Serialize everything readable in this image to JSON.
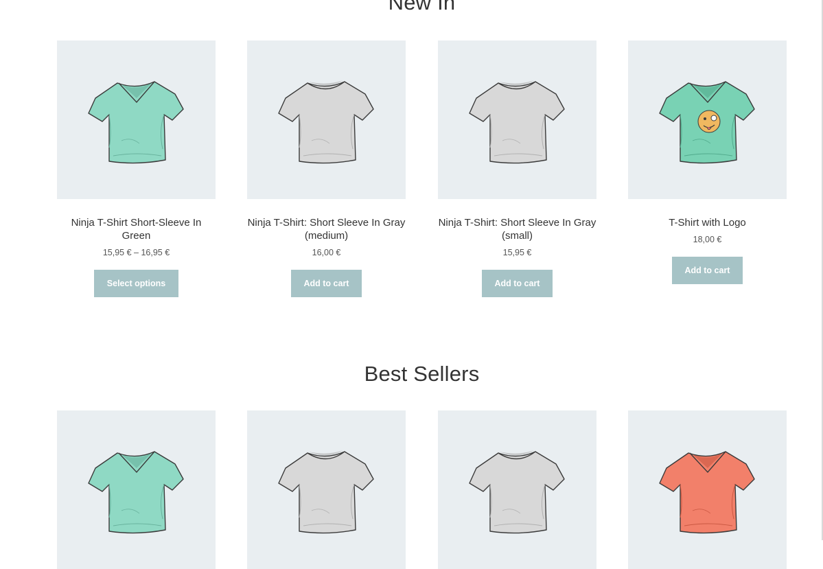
{
  "sections": [
    {
      "title": "New In",
      "products": [
        {
          "name": "Ninja T-Shirt Short-Sleeve In Green",
          "price": "15,95 € – 16,95 €",
          "button": "Select options",
          "shirt": "vneck",
          "color": "#8fd9c4",
          "logo": false
        },
        {
          "name": "Ninja T-Shirt: Short Sleeve In Gray (medium)",
          "price": "16,00 €",
          "button": "Add to cart",
          "shirt": "crew",
          "color": "#d8d8d8",
          "logo": false
        },
        {
          "name": "Ninja T-Shirt: Short Sleeve In Gray (small)",
          "price": "15,95 €",
          "button": "Add to cart",
          "shirt": "crew",
          "color": "#d8d8d8",
          "logo": false
        },
        {
          "name": "T-Shirt with Logo",
          "price": "18,00 €",
          "button": "Add to cart",
          "shirt": "vneck",
          "color": "#79d2b4",
          "logo": true
        }
      ]
    },
    {
      "title": "Best Sellers",
      "products": [
        {
          "shirt": "vneck",
          "color": "#8fd9c4",
          "logo": false
        },
        {
          "shirt": "crew",
          "color": "#d8d8d8",
          "logo": false
        },
        {
          "shirt": "crew",
          "color": "#d8d8d8",
          "logo": false
        },
        {
          "shirt": "vneck",
          "color": "#f2806a",
          "logo": false
        }
      ]
    }
  ]
}
